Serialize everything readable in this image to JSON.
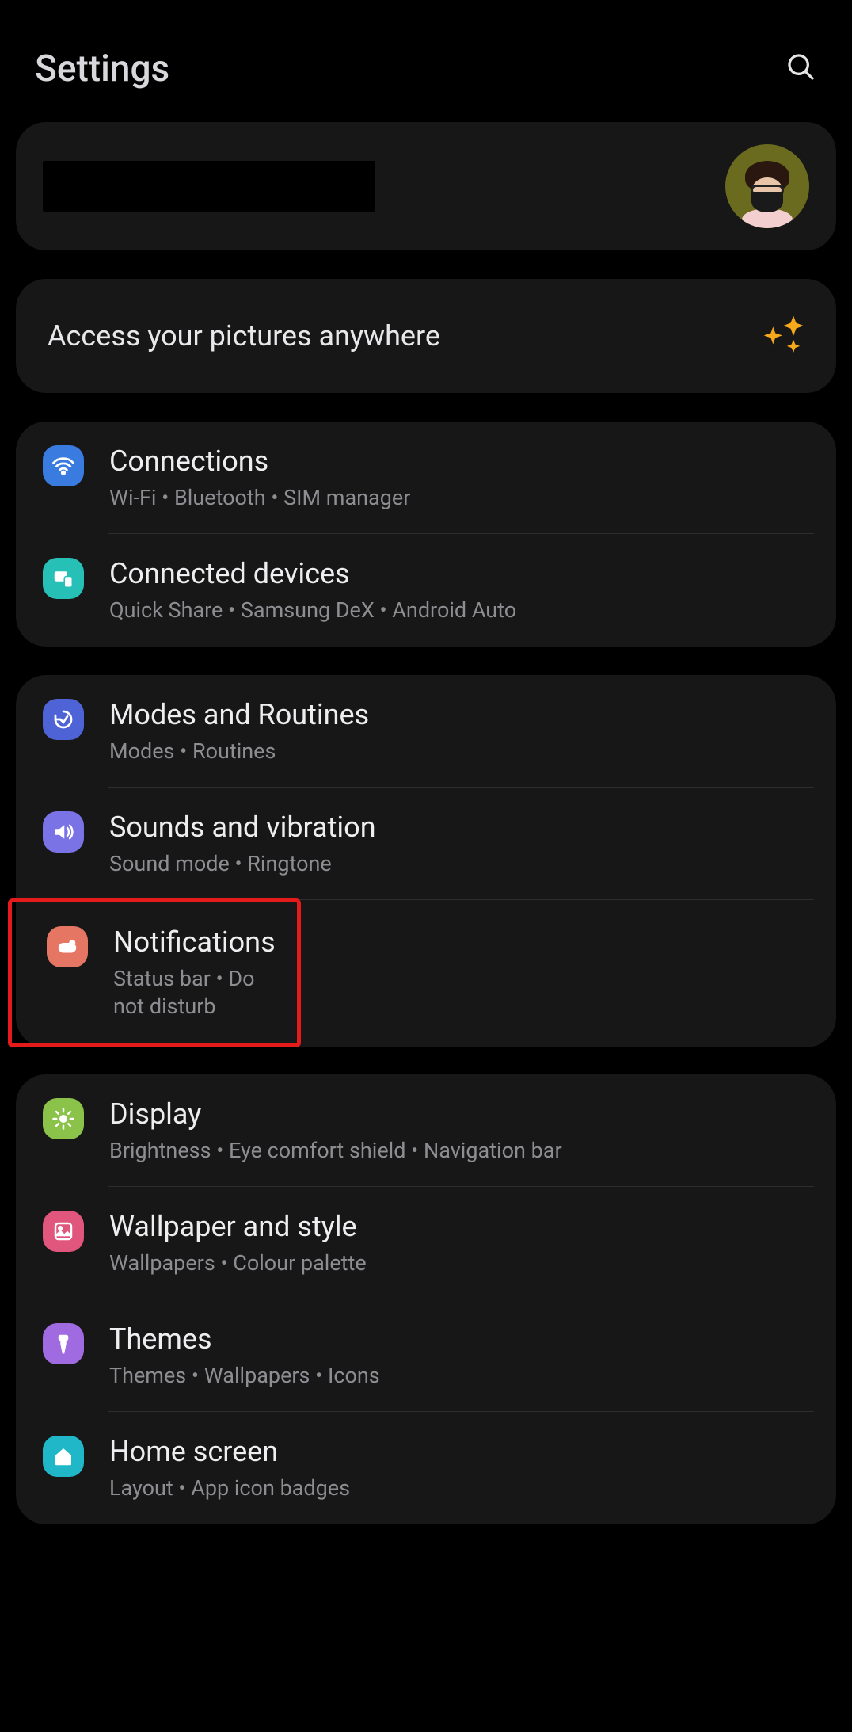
{
  "header": {
    "title": "Settings"
  },
  "promo": {
    "text": "Access your pictures anywhere"
  },
  "sections": [
    {
      "items": [
        {
          "title": "Connections",
          "sub": "Wi-Fi  •  Bluetooth  •  SIM manager"
        },
        {
          "title": "Connected devices",
          "sub": "Quick Share  •  Samsung DeX  •  Android Auto"
        }
      ]
    },
    {
      "items": [
        {
          "title": "Modes and Routines",
          "sub": "Modes  •  Routines"
        },
        {
          "title": "Sounds and vibration",
          "sub": "Sound mode  •  Ringtone"
        },
        {
          "title": "Notifications",
          "sub": "Status bar  •  Do not disturb"
        }
      ]
    },
    {
      "items": [
        {
          "title": "Display",
          "sub": "Brightness  •  Eye comfort shield  •  Navigation bar"
        },
        {
          "title": "Wallpaper and style",
          "sub": "Wallpapers  •  Colour palette"
        },
        {
          "title": "Themes",
          "sub": "Themes  •  Wallpapers  •  Icons"
        },
        {
          "title": "Home screen",
          "sub": "Layout  •  App icon badges"
        }
      ]
    }
  ]
}
